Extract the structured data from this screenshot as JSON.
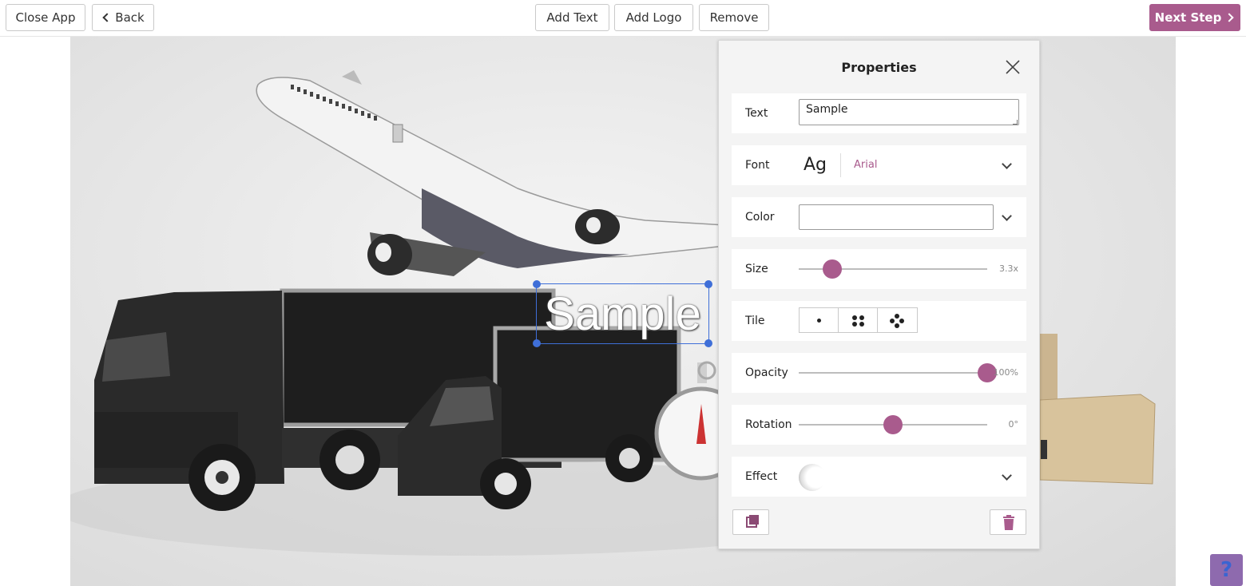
{
  "toolbar": {
    "close_app": "Close App",
    "back": "Back",
    "add_text": "Add Text",
    "add_logo": "Add Logo",
    "remove": "Remove",
    "next_step": "Next Step"
  },
  "canvas": {
    "sample_text": "Sample"
  },
  "properties": {
    "title": "Properties",
    "text": {
      "label": "Text",
      "value": "Sample"
    },
    "font": {
      "label": "Font",
      "preview": "Ag",
      "value": "Arial"
    },
    "color": {
      "label": "Color",
      "value": ""
    },
    "size": {
      "label": "Size",
      "value": "3.3x",
      "level": 0.18
    },
    "tile": {
      "label": "Tile",
      "options": [
        "single-dot-icon",
        "four-dots-icon",
        "diamond-dots-icon"
      ]
    },
    "opacity": {
      "label": "Opacity",
      "value": "100%",
      "level": 1.0
    },
    "rotation": {
      "label": "Rotation",
      "value": "0°",
      "level": 0.5
    },
    "effect": {
      "label": "Effect"
    }
  },
  "help": {
    "label": "?"
  },
  "colors": {
    "accent": "#a95b8d",
    "selection": "#3f6fd8",
    "help_bg": "#8e6aae"
  }
}
